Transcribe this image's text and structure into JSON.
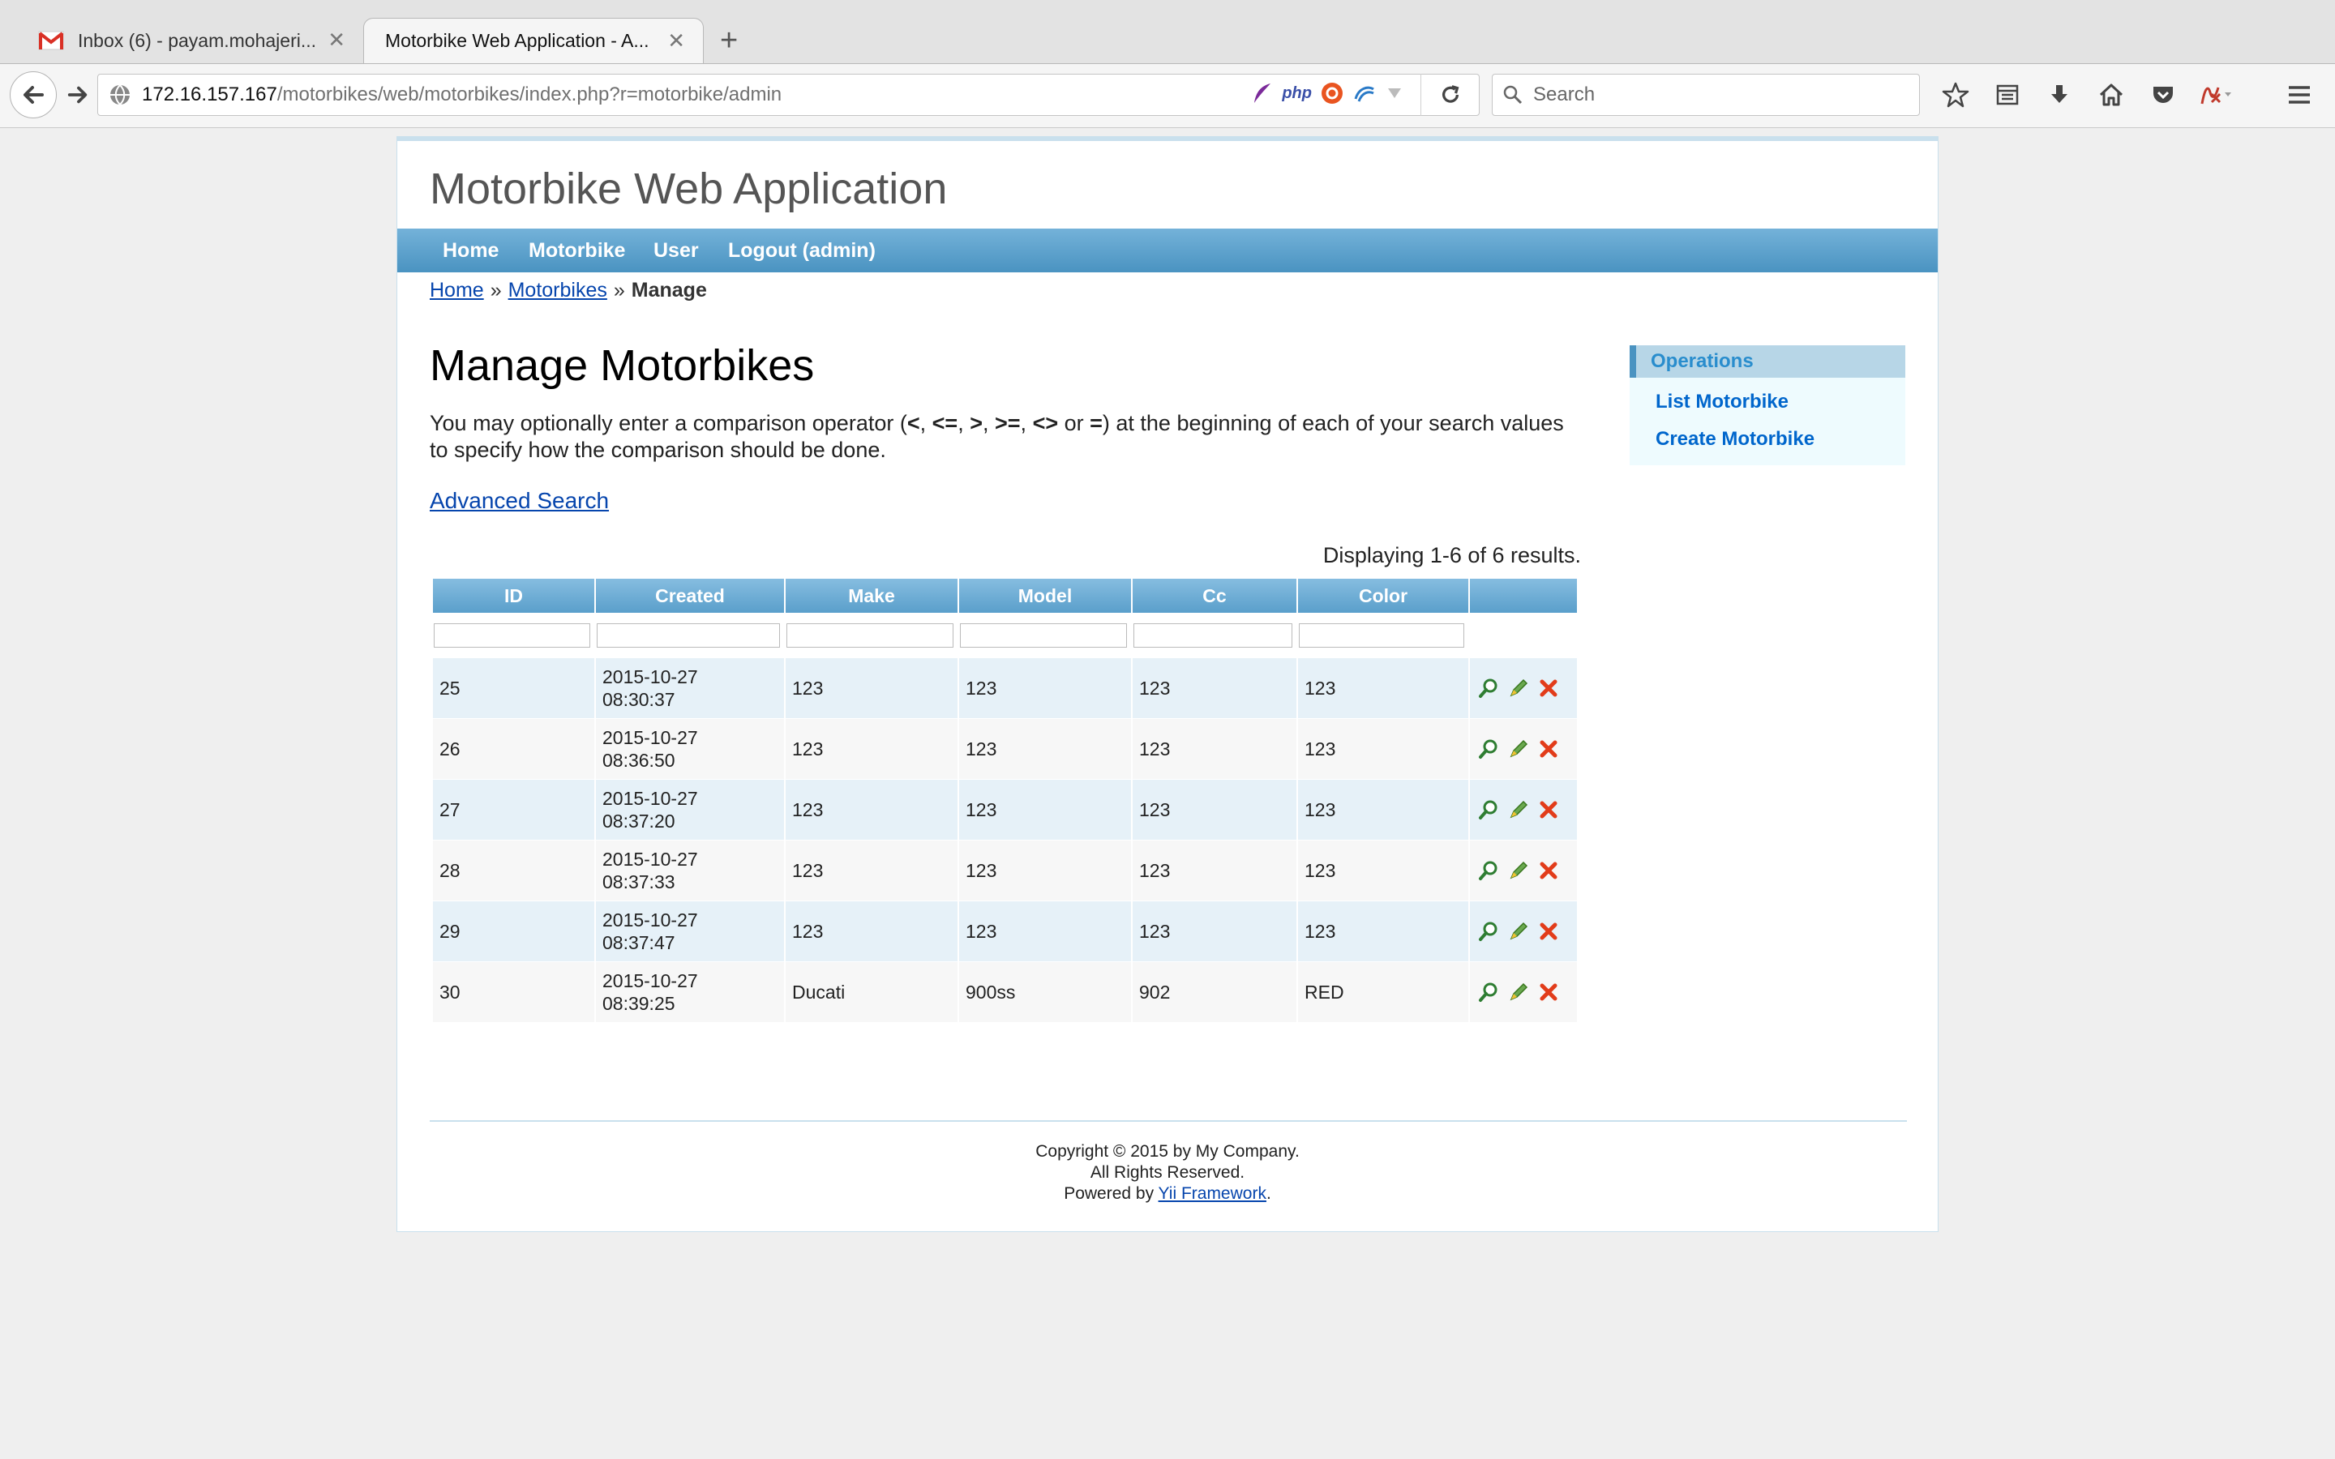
{
  "browser": {
    "tabs": [
      {
        "label": "Inbox (6) - payam.mohajeri...",
        "active": false
      },
      {
        "label": "Motorbike Web Application - A...",
        "active": true
      }
    ],
    "url_host": "172.16.157.167",
    "url_path": "/motorbikes/web/motorbikes/index.php?r=motorbike/admin",
    "search_placeholder": "Search",
    "ext_php": "php"
  },
  "app": {
    "title": "Motorbike Web Application",
    "menu": [
      "Home",
      "Motorbike",
      "User",
      "Logout (admin)"
    ]
  },
  "breadcrumbs": {
    "home": "Home",
    "sep1": "»",
    "motorbikes": "Motorbikes",
    "sep2": "»",
    "current": "Manage"
  },
  "main": {
    "heading": "Manage Motorbikes",
    "hint_1": "You may optionally enter a comparison operator (",
    "op_lt": "<",
    "comma_a": ", ",
    "op_le": "<=",
    "comma_b": ", ",
    "op_gt": ">",
    "comma_c": ", ",
    "op_ge": ">=",
    "comma_d": ", ",
    "op_ne": "<>",
    "or_word": " or ",
    "op_eq": "=",
    "hint_2": ") at the beginning of each of your search values to specify how the comparison should be done.",
    "advanced_search": "Advanced Search",
    "summary": "Displaying 1-6 of 6 results."
  },
  "grid": {
    "columns": [
      "ID",
      "Created",
      "Make",
      "Model",
      "Cc",
      "Color"
    ],
    "rows": [
      {
        "id": "25",
        "date": "2015-10-27",
        "time": "08:30:37",
        "make": "123",
        "model": "123",
        "cc": "123",
        "color": "123"
      },
      {
        "id": "26",
        "date": "2015-10-27",
        "time": "08:36:50",
        "make": "123",
        "model": "123",
        "cc": "123",
        "color": "123"
      },
      {
        "id": "27",
        "date": "2015-10-27",
        "time": "08:37:20",
        "make": "123",
        "model": "123",
        "cc": "123",
        "color": "123"
      },
      {
        "id": "28",
        "date": "2015-10-27",
        "time": "08:37:33",
        "make": "123",
        "model": "123",
        "cc": "123",
        "color": "123"
      },
      {
        "id": "29",
        "date": "2015-10-27",
        "time": "08:37:47",
        "make": "123",
        "model": "123",
        "cc": "123",
        "color": "123"
      },
      {
        "id": "30",
        "date": "2015-10-27",
        "time": "08:39:25",
        "make": "Ducati",
        "model": "900ss",
        "cc": "902",
        "color": "RED"
      }
    ],
    "row_actions": [
      "view-icon",
      "update-icon",
      "delete-icon"
    ]
  },
  "sidebar": {
    "title": "Operations",
    "links": [
      "List Motorbike",
      "Create Motorbike"
    ]
  },
  "footer": {
    "copyright": "Copyright © 2015 by My Company.",
    "rights": "All Rights Reserved.",
    "powered_prefix": "Powered by ",
    "powered_link": "Yii Framework",
    "powered_suffix": "."
  },
  "colors": {
    "menu_bar": "#4a93c1",
    "header_cell": "#6aaad3",
    "odd_row": "#e6f1f8",
    "even_row": "#f7f7f7",
    "link": "#0645ad",
    "sidebar_bg": "#eefbfe"
  }
}
